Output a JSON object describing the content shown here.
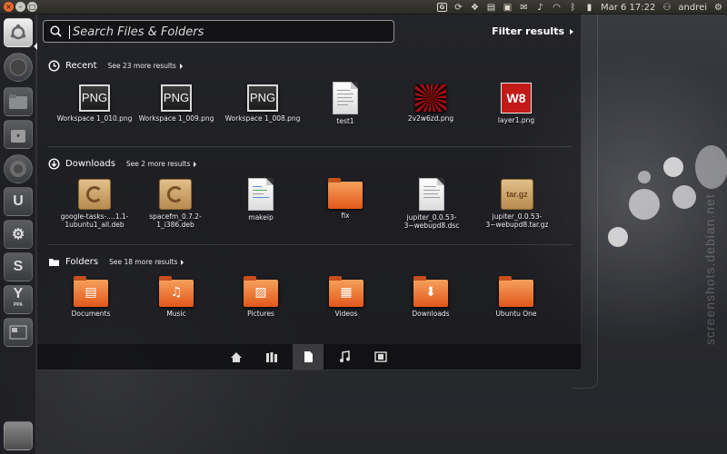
{
  "topbar": {
    "clock": "Mar 6 17:22",
    "user": "andrei",
    "indicator_g": "G"
  },
  "search": {
    "placeholder": "Search Files & Folders",
    "value": ""
  },
  "filter_label": "Filter results",
  "sections": {
    "recent": {
      "title": "Recent",
      "see_more": "See 23 more results",
      "items": [
        {
          "label": "Workspace 1_010.png",
          "thumb_text": "PNG"
        },
        {
          "label": "Workspace 1_009.png",
          "thumb_text": "PNG"
        },
        {
          "label": "Workspace 1_008.png",
          "thumb_text": "PNG"
        },
        {
          "label": "test1"
        },
        {
          "label": "2v2w6zd.png"
        },
        {
          "label": "layer1.png",
          "thumb_text": "W8"
        }
      ]
    },
    "downloads": {
      "title": "Downloads",
      "see_more": "See 2 more results",
      "items": [
        {
          "label": "google-tasks-....1.1-1ubuntu1_all.deb"
        },
        {
          "label": "spacefm_0.7.2-1_i386.deb"
        },
        {
          "label": "makeip"
        },
        {
          "label": "fix"
        },
        {
          "label": "jupiter_0.0.53-3~webupd8.dsc"
        },
        {
          "label": "jupiter_0.0.53-3~webupd8.tar.gz",
          "thumb_text": "tar.gz"
        }
      ]
    },
    "folders": {
      "title": "Folders",
      "see_more": "See 18 more results",
      "items": [
        {
          "label": "Documents"
        },
        {
          "label": "Music"
        },
        {
          "label": "Pictures"
        },
        {
          "label": "Videos"
        },
        {
          "label": "Downloads"
        },
        {
          "label": "Ubuntu One"
        }
      ]
    }
  },
  "launcher": {
    "items": [
      "dash-home",
      "system-settings",
      "file-manager",
      "ubuntu-software-center",
      "firefox",
      "ubuntu-one",
      "settings",
      "software-updater",
      "y-ppa-manager",
      "workspace-switcher"
    ],
    "labels": {
      "ubuntu_one": "U",
      "ppa": "Y",
      "ppa_sub": "PPA"
    }
  },
  "lenses": [
    "home",
    "applications",
    "files",
    "music",
    "video"
  ],
  "active_lens": "files",
  "watermark": "screenshots.debian.net",
  "colors": {
    "accent": "#e2571b",
    "close_button": "#e86a30",
    "panel_bg": "#2b2a27"
  }
}
